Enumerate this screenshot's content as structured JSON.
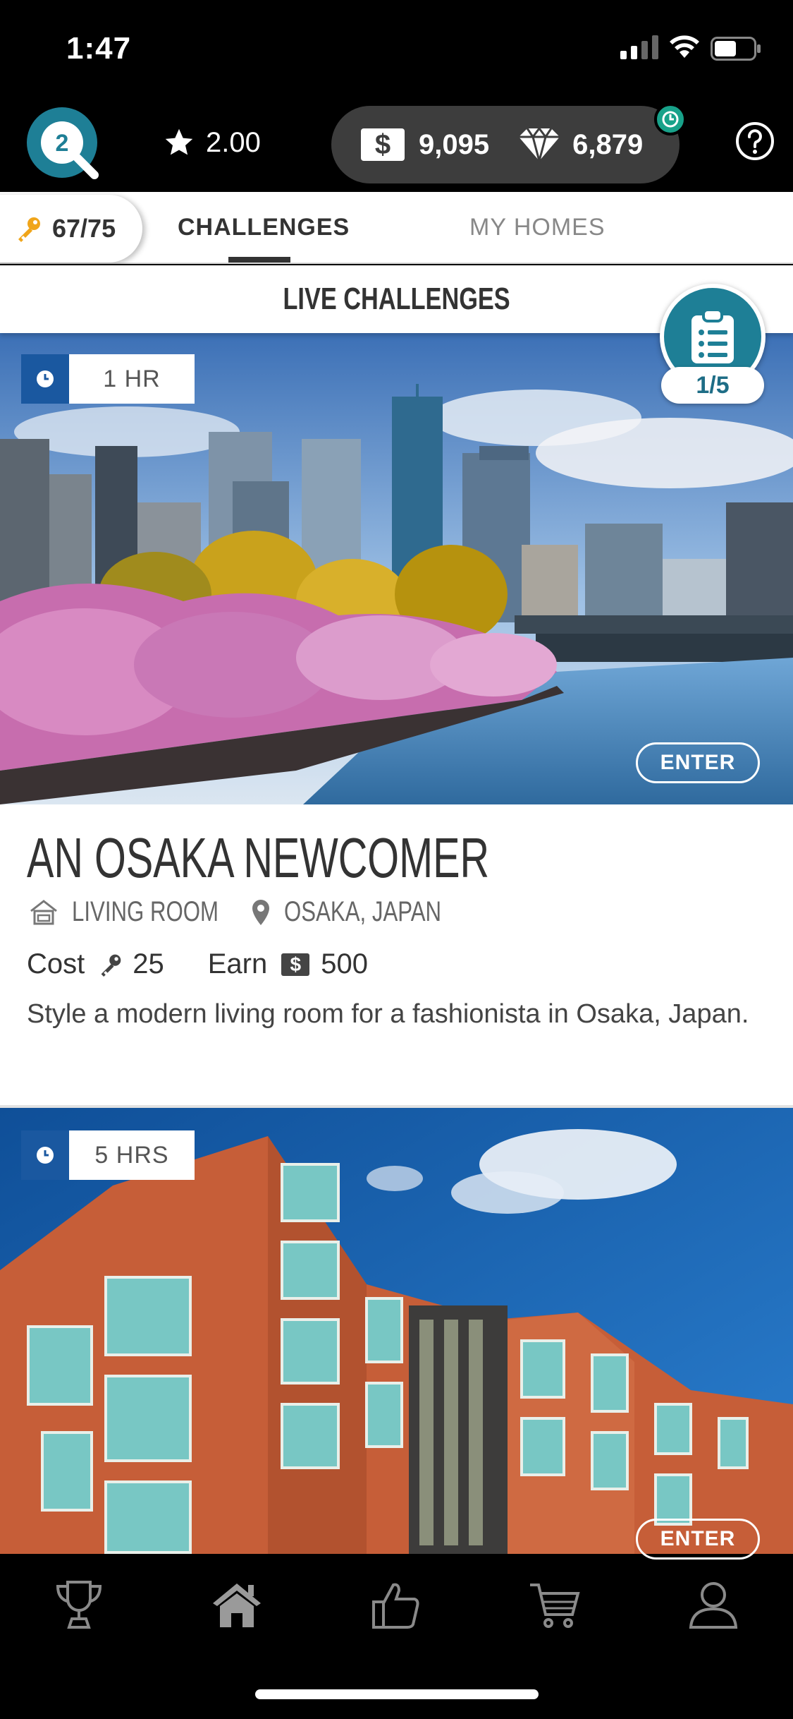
{
  "status_bar": {
    "time": "1:47"
  },
  "top_bar": {
    "level": "2",
    "rating": "2.00",
    "cash": "9,095",
    "gems": "6,879",
    "icons": [
      "level-badge-icon",
      "star-icon",
      "cash-icon",
      "diamond-icon",
      "timer-icon",
      "help-icon"
    ]
  },
  "tabs": {
    "keys": "67/75",
    "items": [
      {
        "label": "CHALLENGES",
        "active": true
      },
      {
        "label": "MY HOMES",
        "active": false
      }
    ]
  },
  "section": {
    "title": "LIVE CHALLENGES"
  },
  "clipboard": {
    "count": "1/5"
  },
  "challenges": [
    {
      "timer": "1 HR",
      "enter_label": "ENTER",
      "title": "AN OSAKA NEWCOMER",
      "room": "LIVING ROOM",
      "location": "OSAKA, JAPAN",
      "cost_label": "Cost",
      "cost": "25",
      "earn_label": "Earn",
      "earn": "500",
      "description": "Style a modern living room for a fashionista in Osaka, Japan."
    },
    {
      "timer": "5 HRS",
      "enter_label": "ENTER"
    }
  ],
  "bottom_nav": [
    "trophy-icon",
    "home-icon",
    "thumbs-up-icon",
    "cart-icon",
    "profile-icon"
  ],
  "colors": {
    "accent": "#1e7f96",
    "timer_blue": "#1a58a0",
    "green": "#18a28a"
  }
}
